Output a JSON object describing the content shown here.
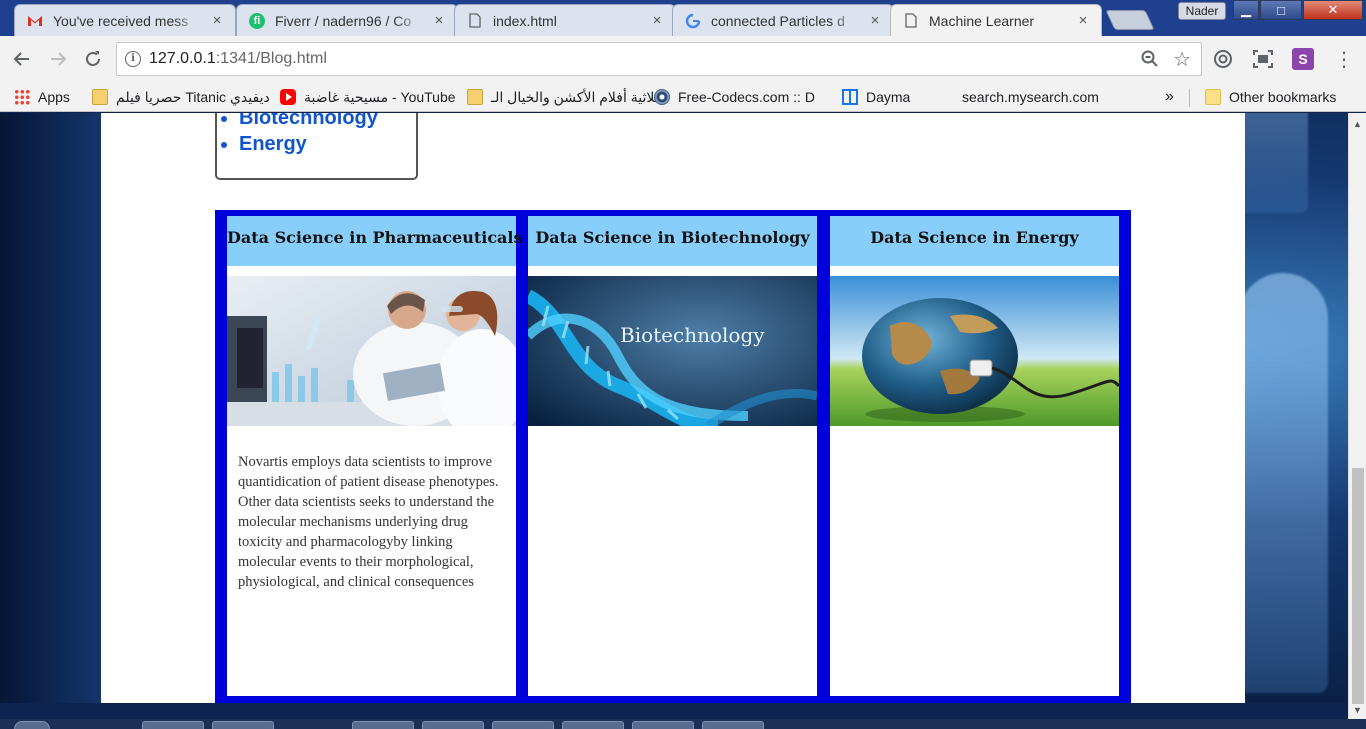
{
  "browser": {
    "tabs": [
      {
        "title": "You've received mess",
        "icon": "gmail-icon",
        "active": false
      },
      {
        "title": "Fiverr / nadern96 / Co",
        "icon": "fiverr-icon",
        "active": false
      },
      {
        "title": "index.html",
        "icon": "page-icon",
        "active": false
      },
      {
        "title": "connected Particles d",
        "icon": "google-icon",
        "active": false
      },
      {
        "title": "Machine Learner",
        "icon": "page-icon",
        "active": true
      }
    ],
    "profile_name": "Nader",
    "window_controls": {
      "minimize": "▁",
      "maximize": "□",
      "close": "✕"
    },
    "url_host": "127.0.0.1",
    "url_rest": ":1341/Blog.html",
    "extension_s_label": "S"
  },
  "bookmarks": {
    "apps": "Apps",
    "items": [
      "حصريا فيلم Titanic ديفيدي",
      "مسيحية غاضبة - YouTube",
      "ثلاثية أفلام الأكشن والخيال الـ",
      "Free-Codecs.com :: D",
      "Dayma",
      "search.mysearch.com"
    ],
    "more": "»",
    "other": "Other bookmarks"
  },
  "toc": {
    "items": [
      "Biotechnology",
      "Energy"
    ]
  },
  "cards": [
    {
      "title": "Data Science in Pharmaceuticals",
      "image": "lab-scientists-image",
      "text": "Novartis employs data scientists to improve quantidication of patient disease phenotypes. Other data scientists seeks to understand the molecular mechanisms underlying drug toxicity and pharmacologyby linking molecular events to their morphological, physiological, and clinical consequences"
    },
    {
      "title": "Data Science in Biotechnology",
      "image": "dna-helix-image",
      "image_caption": "Biotechnology",
      "text": ""
    },
    {
      "title": "Data Science in Energy",
      "image": "earth-battery-image",
      "text": ""
    }
  ],
  "colors": {
    "card_frame": "#0000dd",
    "card_header": "#87cefa",
    "toc_link": "#1155cc"
  }
}
